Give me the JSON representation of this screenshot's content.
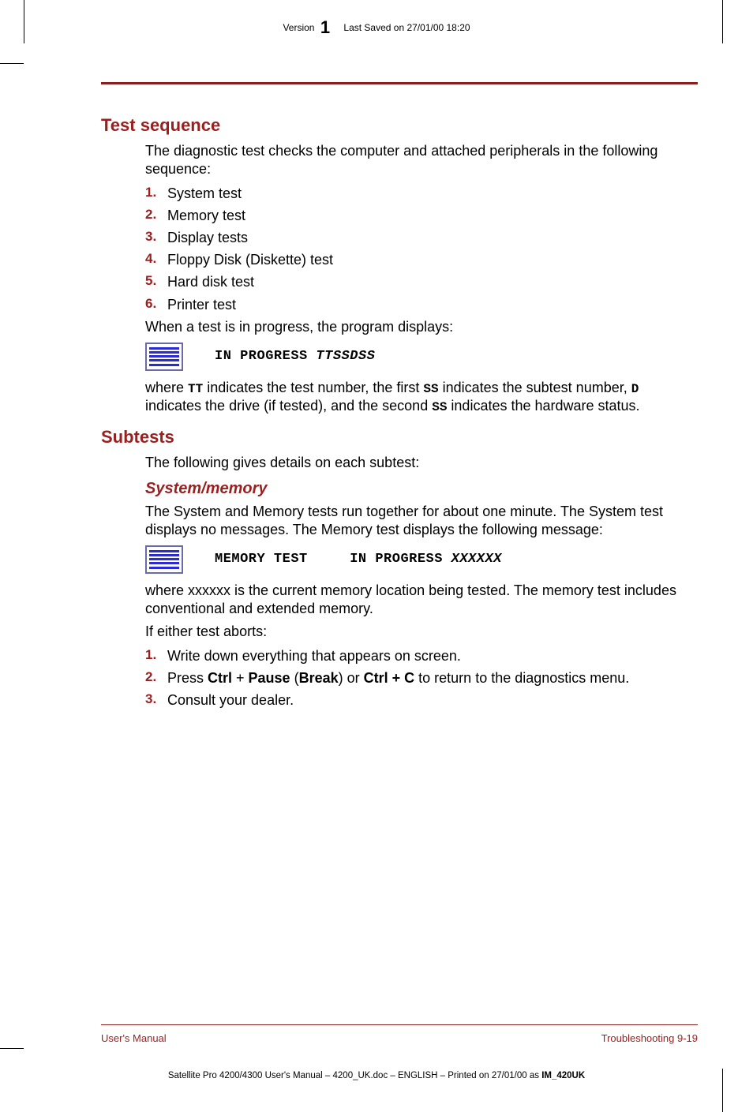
{
  "header": {
    "version_label": "Version",
    "version_number": "1",
    "saved": "Last Saved on 27/01/00 18:20"
  },
  "sections": {
    "test_sequence": {
      "title": "Test sequence",
      "intro": "The diagnostic test checks the computer and attached peripherals in the following sequence:",
      "items": [
        "System test",
        "Memory test",
        "Display tests",
        "Floppy Disk (Diskette) test",
        "Hard disk test",
        "Printer test"
      ],
      "after_list": "When a test is in progress, the program displays:",
      "code": {
        "prefix": "IN PROGRESS ",
        "var": "TTSSDSS"
      },
      "explain_parts": {
        "p1": "where ",
        "tt": "TT",
        "p2": " indicates the test number, the first ",
        "ss1": "SS",
        "p3": " indicates the subtest number, ",
        "d": "D",
        "p4": " indicates the drive (if tested), and the second ",
        "ss2": "SS",
        "p5": " indicates the hardware status."
      }
    },
    "subtests": {
      "title": "Subtests",
      "intro": "The following gives details on each subtest:",
      "system_memory": {
        "title": "System/memory",
        "para": "The System and Memory tests run together for about one minute. The System test displays no messages. The Memory test displays the following message:",
        "code": {
          "label": "MEMORY TEST",
          "mid": "IN PROGRESS ",
          "var": "XXXXXX"
        },
        "explain": "where xxxxxx is the current memory location being tested. The memory test includes conventional and extended memory.",
        "abort_intro": "If either test aborts:",
        "steps": {
          "s1": "Write down everything that appears on screen.",
          "s2a": "Press ",
          "s2_ctrl": "Ctrl",
          "s2b": " + ",
          "s2_pause": "Pause",
          "s2c": " (",
          "s2_break": "Break",
          "s2d": ") or ",
          "s2_ctrlc": "Ctrl + C",
          "s2e": " to return to the diagnostics menu.",
          "s3": "Consult your dealer."
        }
      }
    }
  },
  "footer": {
    "left": "User's Manual",
    "right": "Troubleshooting  9-19"
  },
  "bottom": {
    "text": "Satellite Pro 4200/4300 User's Manual  – 4200_UK.doc – ENGLISH – Printed on 27/01/00 as ",
    "bold": "IM_420UK"
  }
}
